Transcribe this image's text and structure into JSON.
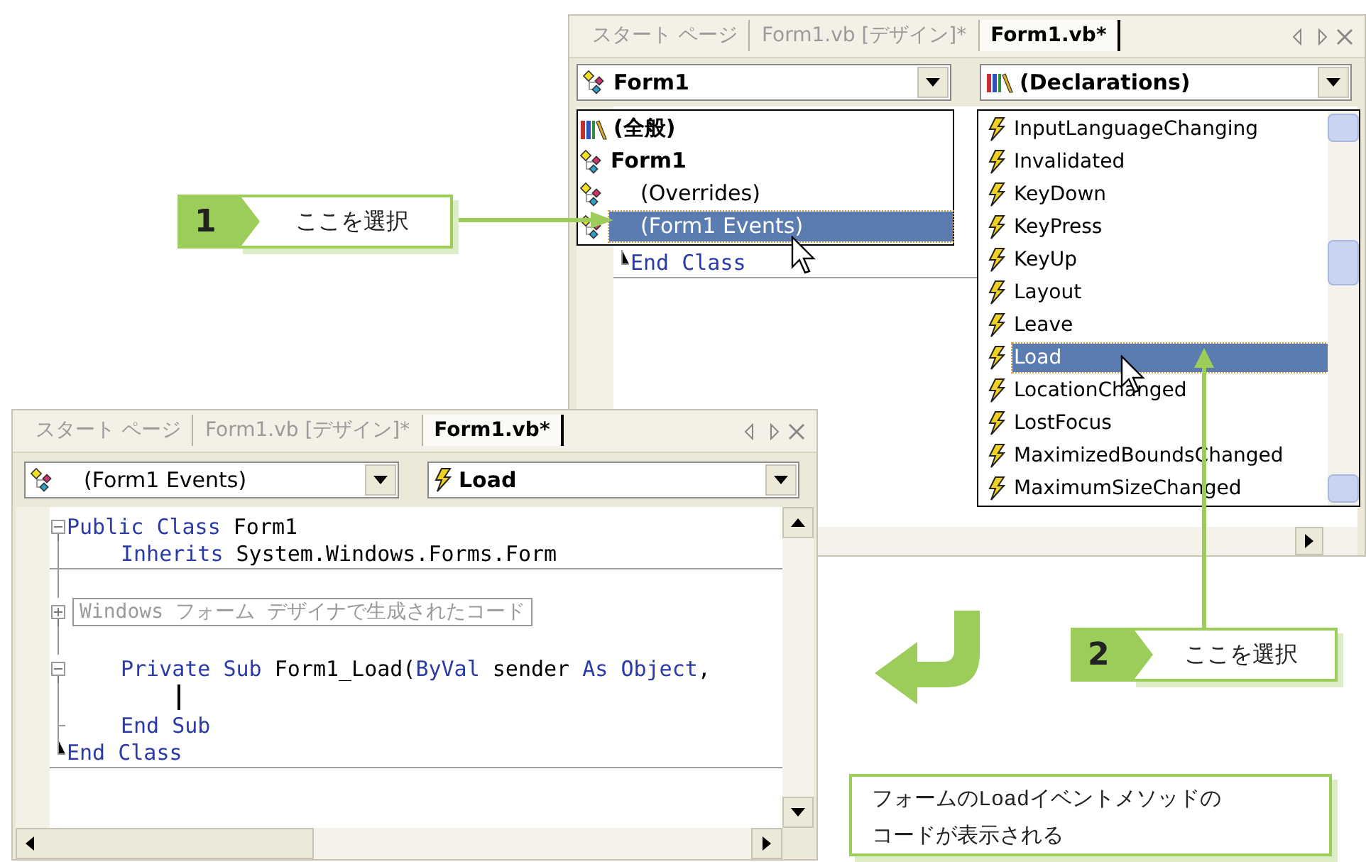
{
  "top_window": {
    "tabs": [
      {
        "label": "スタート ページ",
        "selected": false
      },
      {
        "label": "Form1.vb [デザイン]*",
        "selected": false
      },
      {
        "label": "Form1.vb*",
        "selected": true
      }
    ],
    "object_combo": {
      "value": "Form1",
      "kind": "class"
    },
    "event_combo": {
      "value": "(Declarations)",
      "kind": "declarations"
    },
    "code_lines": [
      {
        "kind": "close",
        "tokens": [
          {
            "text": "End Class",
            "kind": "keyword"
          }
        ]
      }
    ],
    "object_list": [
      {
        "label": "(全般)",
        "kind": "general",
        "selected": false
      },
      {
        "label": "Form1",
        "kind": "class",
        "selected": false
      },
      {
        "label": "(Overrides)",
        "kind": "member",
        "selected": false
      },
      {
        "label": "(Form1 Events)",
        "kind": "member",
        "selected": true
      }
    ],
    "event_list": [
      {
        "label": "InputLanguageChanging",
        "selected": false
      },
      {
        "label": "Invalidated",
        "selected": false
      },
      {
        "label": "KeyDown",
        "selected": false
      },
      {
        "label": "KeyPress",
        "selected": false
      },
      {
        "label": "KeyUp",
        "selected": false
      },
      {
        "label": "Layout",
        "selected": false
      },
      {
        "label": "Leave",
        "selected": false
      },
      {
        "label": "Load",
        "selected": true
      },
      {
        "label": "LocationChanged",
        "selected": false
      },
      {
        "label": "LostFocus",
        "selected": false
      },
      {
        "label": "MaximizedBoundsChanged",
        "selected": false
      },
      {
        "label": "MaximumSizeChanged",
        "selected": false
      }
    ]
  },
  "bottom_window": {
    "tabs": [
      {
        "label": "スタート ページ",
        "selected": false
      },
      {
        "label": "Form1.vb [デザイン]*",
        "selected": false
      },
      {
        "label": "Form1.vb*",
        "selected": true
      }
    ],
    "object_combo": {
      "value": "(Form1 Events)",
      "kind": "member"
    },
    "event_combo": {
      "value": "Load",
      "kind": "event"
    },
    "code_lines": [
      {
        "kind": "open",
        "tokens": [
          {
            "text": "Public Class",
            "kind": "keyword"
          },
          {
            "text": " Form1",
            "kind": "plain"
          }
        ]
      },
      {
        "kind": "inner",
        "tokens": [
          {
            "text": "Inherits",
            "kind": "keyword"
          },
          {
            "text": " System.Windows.Forms.Form",
            "kind": "plain"
          }
        ]
      },
      {
        "kind": "blank"
      },
      {
        "kind": "region",
        "tokens": [
          {
            "text": "Windows フォーム デザイナで生成されたコード",
            "kind": "region"
          }
        ]
      },
      {
        "kind": "blank"
      },
      {
        "kind": "inner-open",
        "tokens": [
          {
            "text": "Private Sub",
            "kind": "keyword"
          },
          {
            "text": " Form1_Load(",
            "kind": "plain"
          },
          {
            "text": "ByVal",
            "kind": "keyword"
          },
          {
            "text": " sender ",
            "kind": "plain"
          },
          {
            "text": "As Object",
            "kind": "keyword"
          },
          {
            "text": ",",
            "kind": "plain"
          }
        ]
      },
      {
        "kind": "caret"
      },
      {
        "kind": "inner-close",
        "tokens": [
          {
            "text": "End Sub",
            "kind": "keyword"
          }
        ]
      },
      {
        "kind": "close",
        "tokens": [
          {
            "text": "End Class",
            "kind": "keyword"
          }
        ]
      }
    ]
  },
  "callouts": [
    {
      "number": "1",
      "text": "ここを選択"
    },
    {
      "number": "2",
      "text": "ここを選択"
    }
  ],
  "note": {
    "lines": [
      {
        "parts": [
          {
            "text": "フォームの",
            "kind": "plain"
          },
          {
            "text": "Load",
            "kind": "code"
          },
          {
            "text": "イベントメソッドの",
            "kind": "plain"
          }
        ]
      },
      {
        "parts": [
          {
            "text": "コードが表示される",
            "kind": "plain"
          }
        ]
      }
    ]
  }
}
